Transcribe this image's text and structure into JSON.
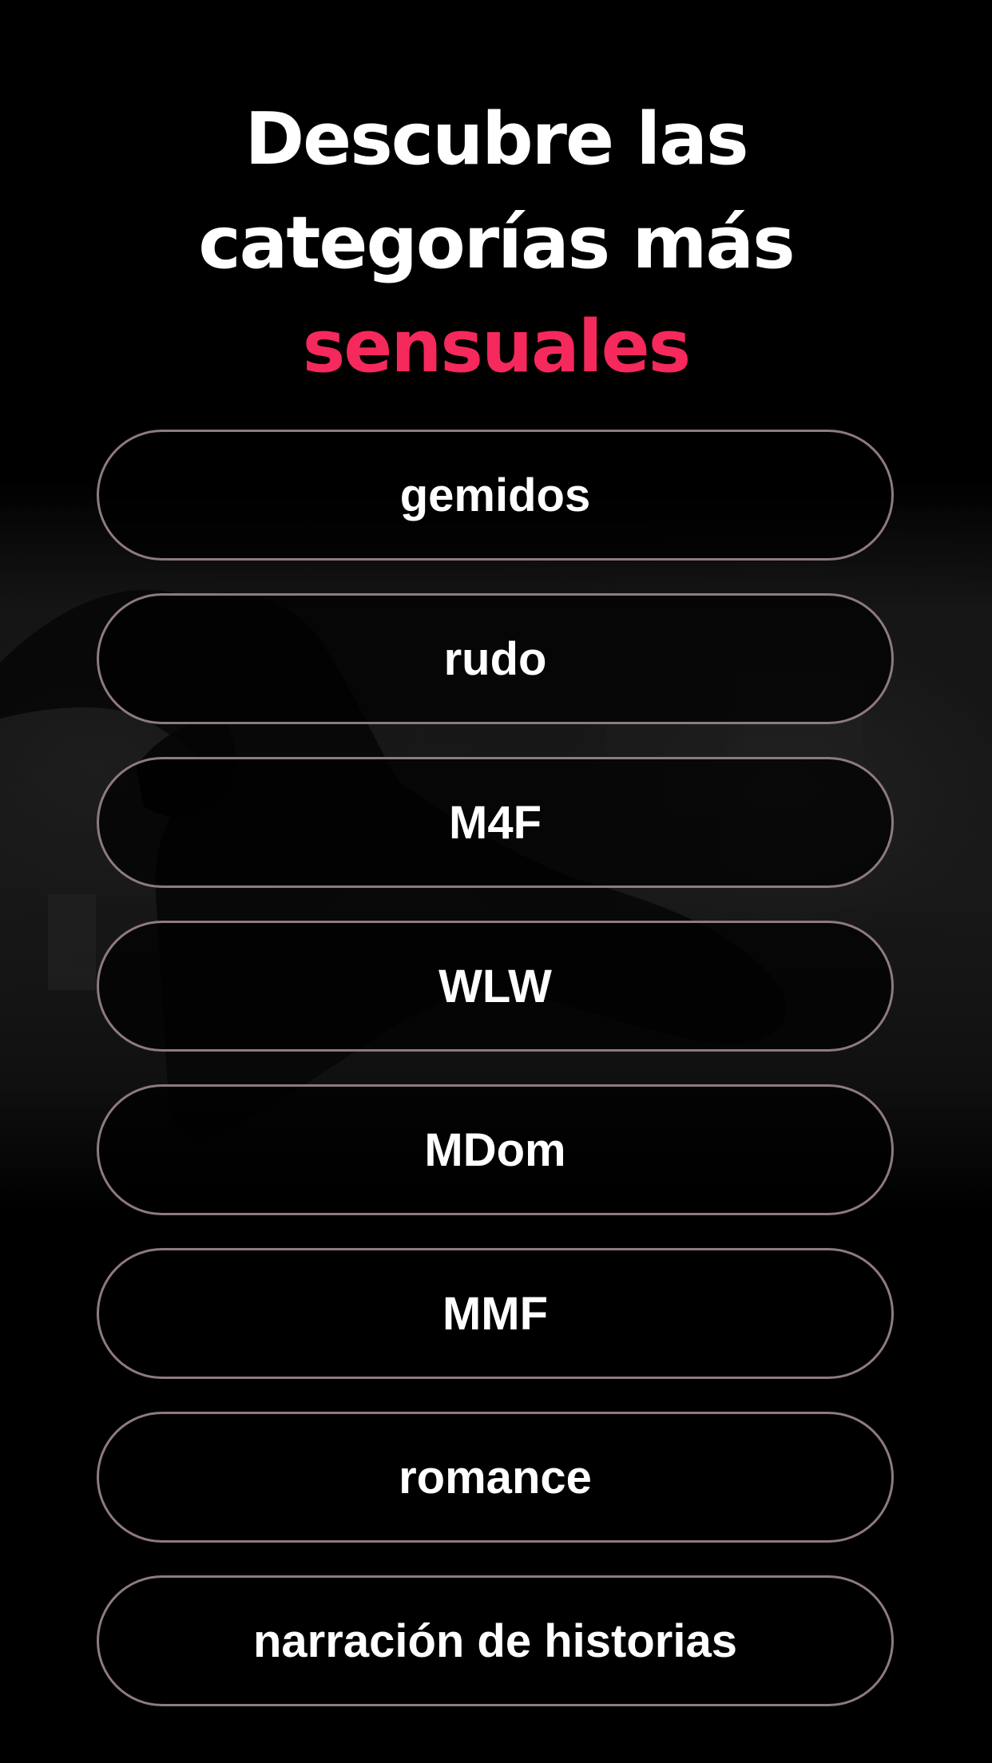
{
  "headline": {
    "line1": "Descubre las",
    "line2": "categorías más",
    "accent": "sensuales"
  },
  "options": [
    "gemidos",
    "rudo",
    "M4F",
    "WLW",
    "MDom",
    "MMF",
    "romance",
    "narración de historias"
  ],
  "colors": {
    "background": "#000000",
    "accent": "#f5295b",
    "pill_border": "#8e7a80",
    "text": "#ffffff"
  }
}
